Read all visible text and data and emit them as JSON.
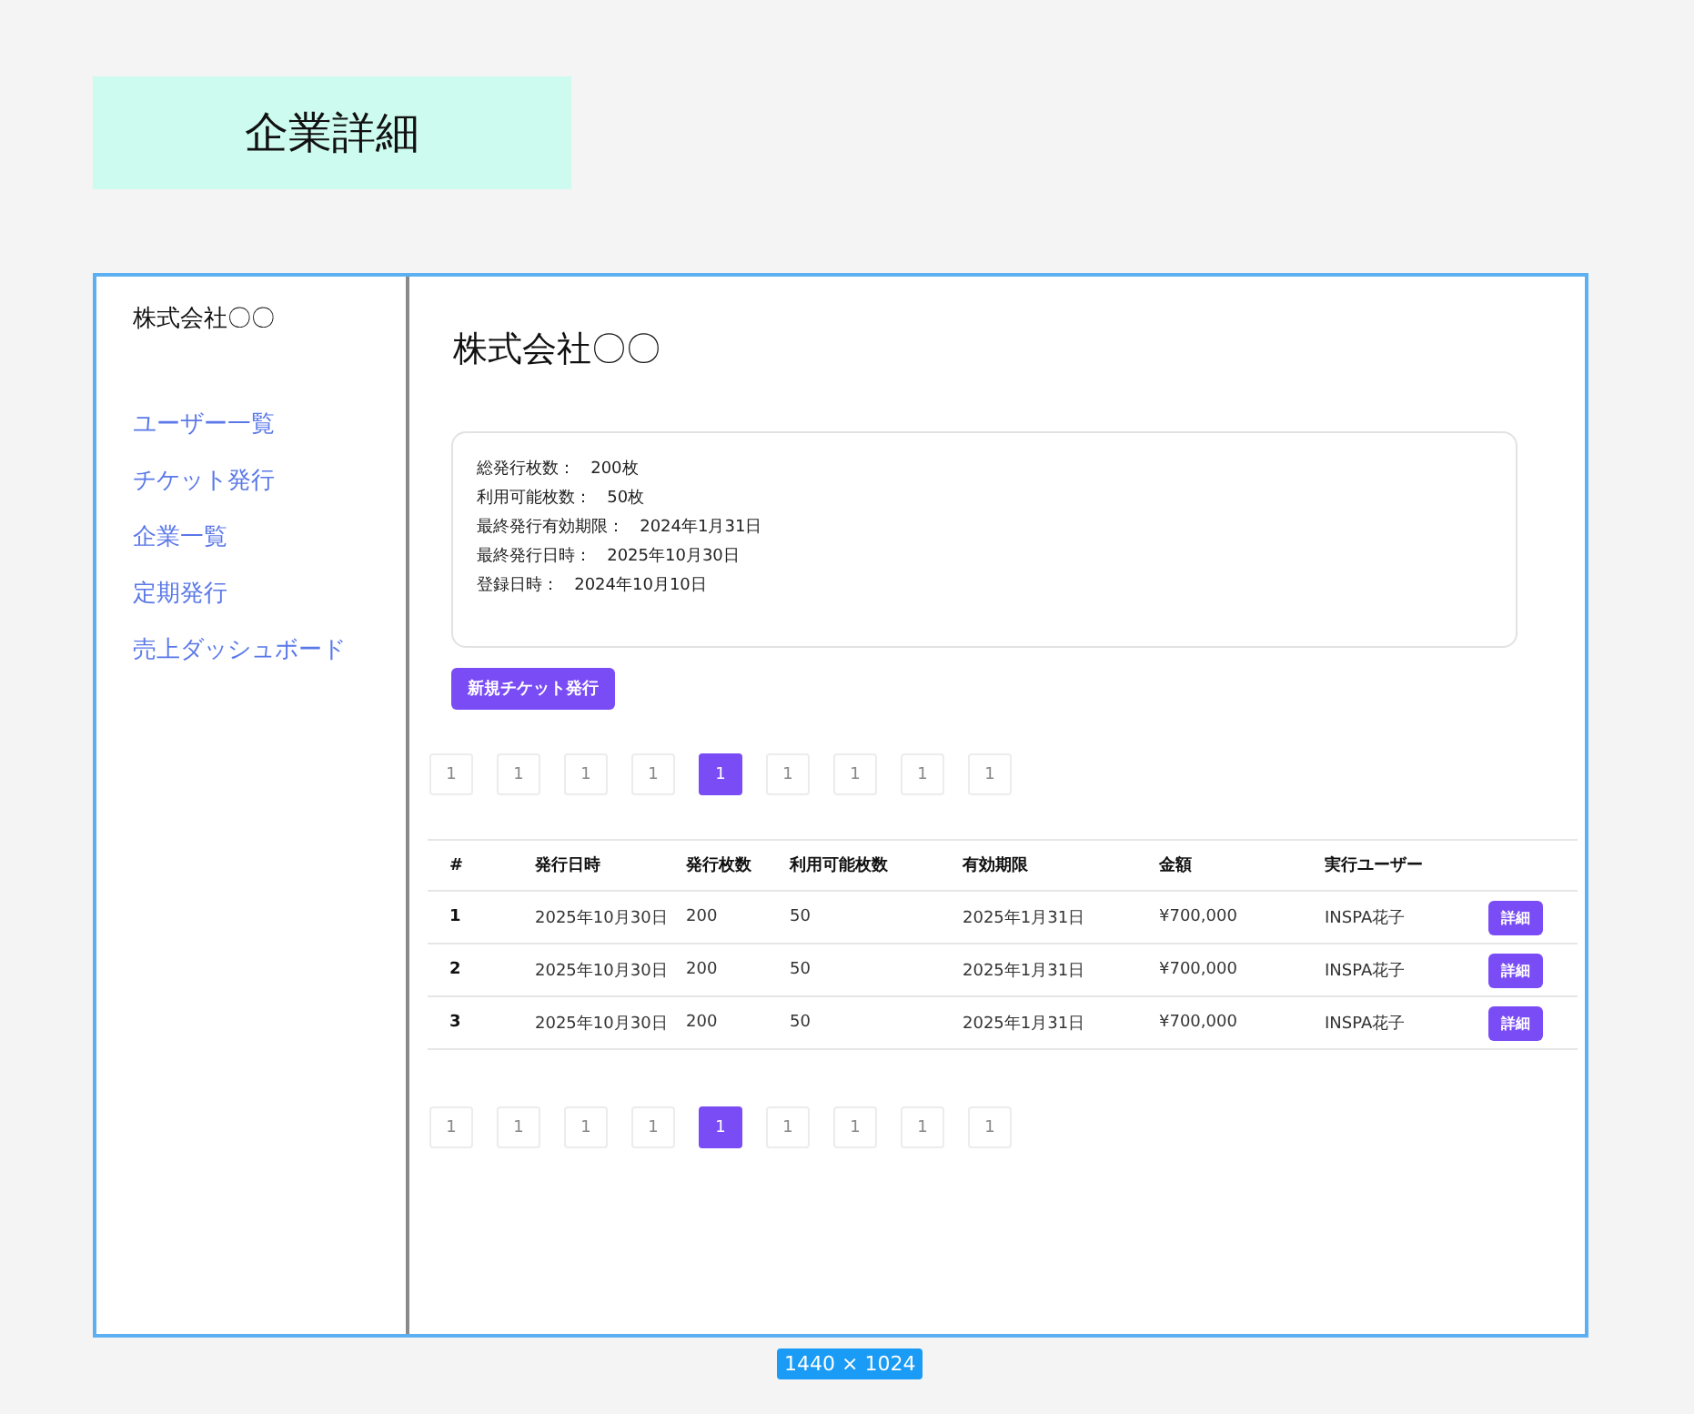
{
  "page_tag": {
    "title": "企業詳細"
  },
  "sidebar": {
    "company": "株式会社〇〇",
    "items": [
      {
        "label": "ユーザー一覧"
      },
      {
        "label": "チケット発行"
      },
      {
        "label": "企業一覧"
      },
      {
        "label": "定期発行"
      },
      {
        "label": "売上ダッシュボード"
      }
    ]
  },
  "main": {
    "title": "株式会社〇〇",
    "summary": [
      {
        "label": "総発行枚数：",
        "value": "200枚"
      },
      {
        "label": "利用可能枚数：",
        "value": "50枚"
      },
      {
        "label": "最終発行有効期限：",
        "value": "2024年1月31日"
      },
      {
        "label": "最終発行日時：",
        "value": "2025年10月30日"
      },
      {
        "label": "登録日時：",
        "value": "2024年10月10日"
      }
    ],
    "new_button": "新規チケット発行",
    "pagination_top": [
      {
        "label": "1",
        "selected": false
      },
      {
        "label": "1",
        "selected": false
      },
      {
        "label": "1",
        "selected": false
      },
      {
        "label": "1",
        "selected": false
      },
      {
        "label": "1",
        "selected": true
      },
      {
        "label": "1",
        "selected": false
      },
      {
        "label": "1",
        "selected": false
      },
      {
        "label": "1",
        "selected": false
      },
      {
        "label": "1",
        "selected": false
      }
    ],
    "table": {
      "columns": [
        "#",
        "発行日時",
        "発行枚数",
        "利用可能枚数",
        "有効期限",
        "金額",
        "実行ユーザー"
      ],
      "rows": [
        {
          "cells": [
            "1",
            "2025年10月30日",
            "200",
            "50",
            "2025年1月31日",
            "¥700,000",
            "INSPA花子"
          ],
          "action": "詳細"
        },
        {
          "cells": [
            "2",
            "2025年10月30日",
            "200",
            "50",
            "2025年1月31日",
            "¥700,000",
            "INSPA花子"
          ],
          "action": "詳細"
        },
        {
          "cells": [
            "3",
            "2025年10月30日",
            "200",
            "50",
            "2025年1月31日",
            "¥700,000",
            "INSPA花子"
          ],
          "action": "詳細"
        }
      ]
    },
    "pagination_bottom": [
      {
        "label": "1",
        "selected": false
      },
      {
        "label": "1",
        "selected": false
      },
      {
        "label": "1",
        "selected": false
      },
      {
        "label": "1",
        "selected": false
      },
      {
        "label": "1",
        "selected": true
      },
      {
        "label": "1",
        "selected": false
      },
      {
        "label": "1",
        "selected": false
      },
      {
        "label": "1",
        "selected": false
      },
      {
        "label": "1",
        "selected": false
      }
    ]
  },
  "frame_size": "1440 × 1024"
}
